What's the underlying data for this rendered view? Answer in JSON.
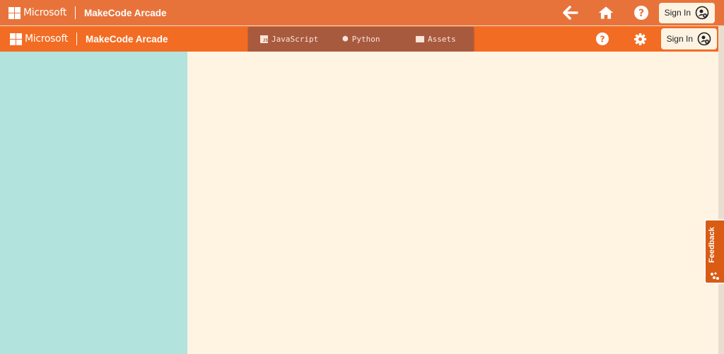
{
  "outer_header": {
    "brand": "Microsoft",
    "app_title": "MakeCode Arcade",
    "sign_in": "Sign In"
  },
  "inner_header": {
    "brand": "Microsoft",
    "app_title": "MakeCode Arcade",
    "sign_in": "Sign In",
    "tabs": [
      {
        "label": "JavaScript",
        "icon": "js-icon"
      },
      {
        "label": "Python",
        "icon": "python-icon"
      },
      {
        "label": "Assets",
        "icon": "image-icon"
      }
    ]
  },
  "feedback": {
    "label": "Feedback"
  },
  "colors": {
    "outer": "#e8733a",
    "inner": "#f26c23",
    "tabs": "#a85a3f",
    "sidebar": "#b2e3dc",
    "main": "#fff3e1"
  }
}
